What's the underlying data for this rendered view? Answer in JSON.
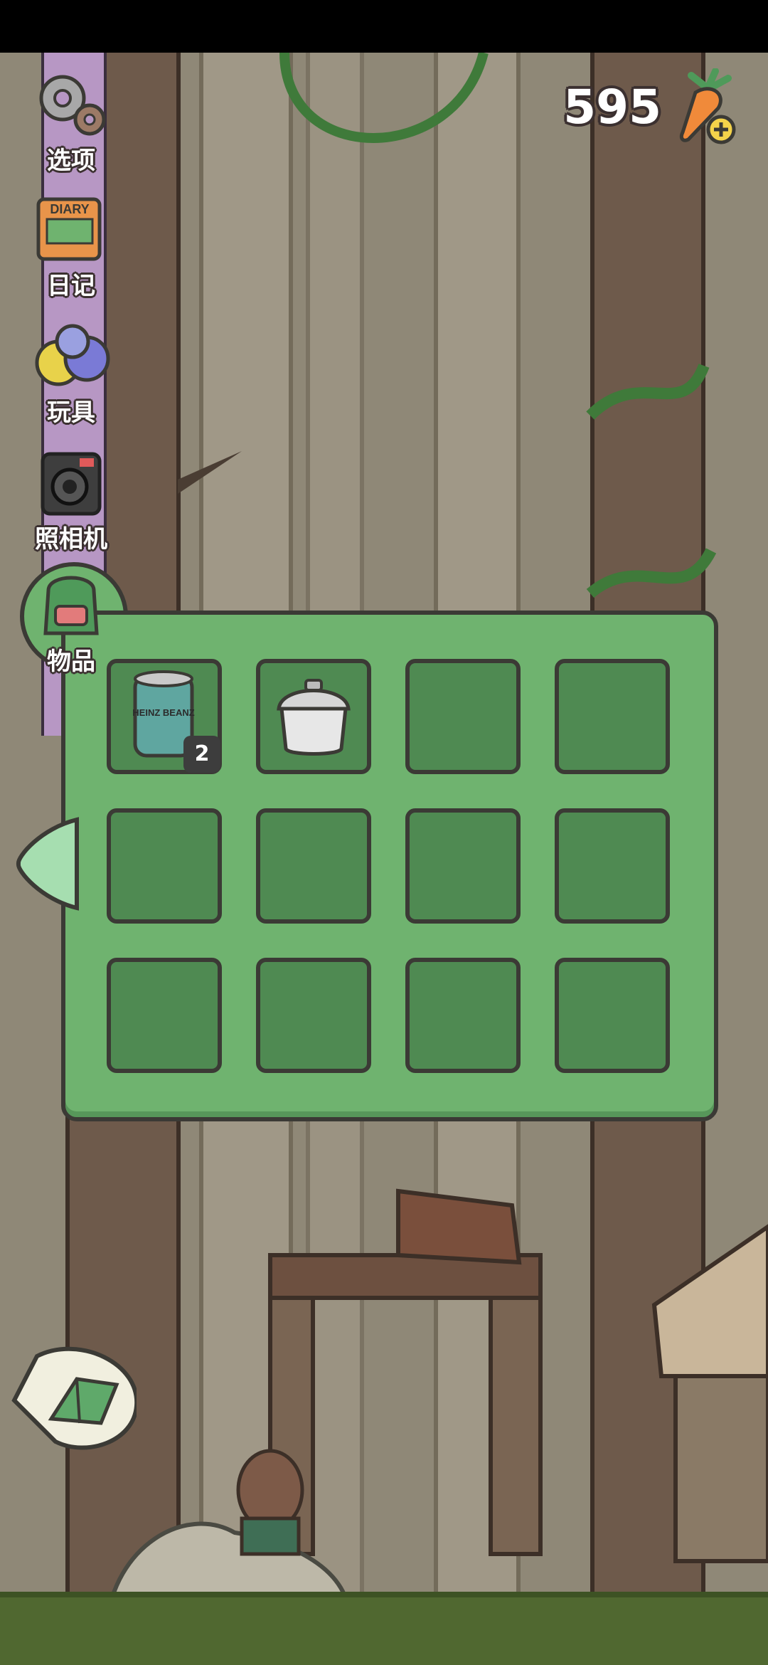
{
  "score": "595",
  "menu": [
    {
      "label": "选项",
      "icon": "gears-icon"
    },
    {
      "label": "日记",
      "icon": "diary-book-icon"
    },
    {
      "label": "玩具",
      "icon": "toy-balls-icon"
    },
    {
      "label": "照相机",
      "icon": "camera-icon"
    },
    {
      "label": "物品",
      "icon": "backpack-icon"
    }
  ],
  "diary_cover_text": "DIARY",
  "inventory": {
    "slots": [
      {
        "item": "canned-beans-icon",
        "label": "HEINZ BEANZ",
        "count": "2"
      },
      {
        "item": "rice-cooker-icon"
      },
      {},
      {},
      {},
      {},
      {},
      {},
      {},
      {},
      {},
      {}
    ]
  },
  "colors": {
    "panel": "#6fb36f",
    "slot": "#4f8a52",
    "outline": "#3b3a35",
    "sidebar": "#b797c4"
  }
}
